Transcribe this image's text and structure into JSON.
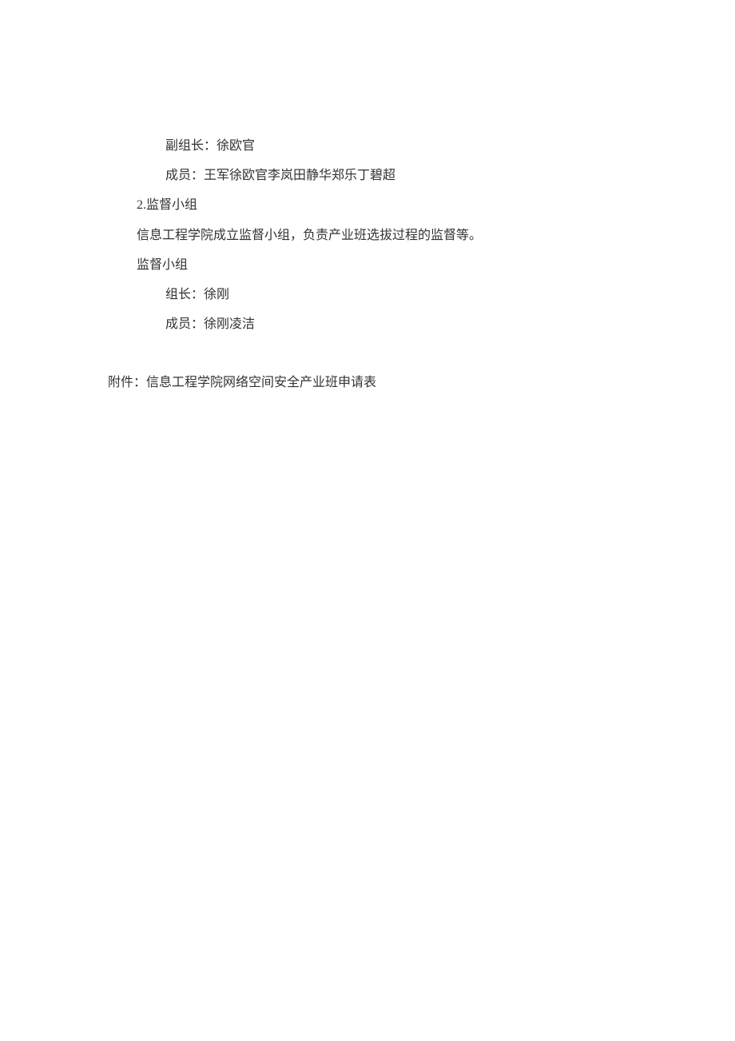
{
  "lines": {
    "l1": "副组长：徐欧官",
    "l2": "成员：王军徐欧官李岚田静华郑乐丁碧超",
    "l3": "2.监督小组",
    "l4": "信息工程学院成立监督小组，负责产业班选拔过程的监督等。",
    "l5": "监督小组",
    "l6": "组长：徐刚",
    "l7": "成员：徐刚凌洁",
    "l8": "附件：信息工程学院网络空间安全产业班申请表"
  }
}
